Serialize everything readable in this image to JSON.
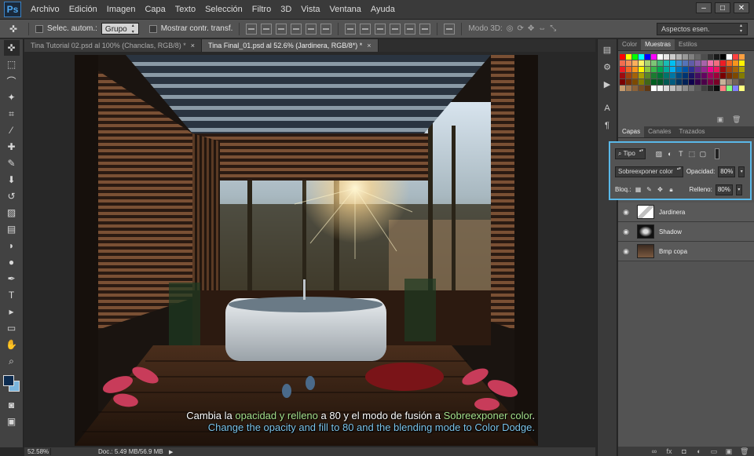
{
  "app": {
    "logo": "Ps"
  },
  "menu": [
    "Archivo",
    "Edición",
    "Imagen",
    "Capa",
    "Texto",
    "Selección",
    "Filtro",
    "3D",
    "Vista",
    "Ventana",
    "Ayuda"
  ],
  "window_controls": {
    "minimize": "–",
    "restore": "□",
    "close": "✕"
  },
  "options_bar": {
    "auto_select_label": "Selec. autom.:",
    "auto_select_target": "Grupo",
    "transform_label": "Mostrar contr. transf.",
    "mode_3d_label": "Modo 3D:",
    "workspace": "Aspectos esen."
  },
  "doc_tabs": [
    {
      "title": "Tina Tutorial 02.psd al 100% (Chanclas, RGB/8) *",
      "close": "×"
    },
    {
      "title": "Tina Final_01.psd al 52.6% (Jardinera, RGB/8*) *",
      "close": "×"
    }
  ],
  "status": {
    "zoom": "52.58%",
    "doc_info": "Doc.: 5.49 MB/56.9 MB",
    "arrow": "▶"
  },
  "caption": {
    "es_parts": [
      "Cambia la ",
      "opacidad y relleno",
      " a 80 y el modo de fusión a ",
      "Sobreexponer color",
      "."
    ],
    "en": "Change the opacity and fill to 80 and the blending mode to Color Dodge."
  },
  "tools": [
    {
      "name": "move-tool-icon",
      "glyph": "✜"
    },
    {
      "name": "marquee-tool-icon",
      "glyph": "⬚"
    },
    {
      "name": "lasso-tool-icon",
      "glyph": "⌒"
    },
    {
      "name": "quick-select-tool-icon",
      "glyph": "✦"
    },
    {
      "name": "crop-tool-icon",
      "glyph": "⌗"
    },
    {
      "name": "eyedropper-tool-icon",
      "glyph": "⁄"
    },
    {
      "name": "healing-brush-tool-icon",
      "glyph": "✚"
    },
    {
      "name": "brush-tool-icon",
      "glyph": "✎"
    },
    {
      "name": "clone-stamp-tool-icon",
      "glyph": "⬇"
    },
    {
      "name": "history-brush-tool-icon",
      "glyph": "↺"
    },
    {
      "name": "eraser-tool-icon",
      "glyph": "▨"
    },
    {
      "name": "gradient-tool-icon",
      "glyph": "▤"
    },
    {
      "name": "blur-tool-icon",
      "glyph": "◗"
    },
    {
      "name": "dodge-tool-icon",
      "glyph": "●"
    },
    {
      "name": "pen-tool-icon",
      "glyph": "✒"
    },
    {
      "name": "type-tool-icon",
      "glyph": "T"
    },
    {
      "name": "path-select-tool-icon",
      "glyph": "▸"
    },
    {
      "name": "shape-tool-icon",
      "glyph": "▭"
    },
    {
      "name": "hand-tool-icon",
      "glyph": "✋"
    },
    {
      "name": "zoom-tool-icon",
      "glyph": "⌕"
    }
  ],
  "colors": {
    "foreground": "#0d2c50",
    "background": "#79b5dd",
    "accent": "#5ab8e8"
  },
  "swatch_panel": {
    "tabs": [
      "Color",
      "Muestras",
      "Estilos"
    ],
    "active": 1
  },
  "layers_panel": {
    "tabs": [
      "Capas",
      "Canales",
      "Trazados"
    ],
    "active": 0,
    "filter_kind": "Tipo",
    "blend_mode": "Sobreexponer color",
    "opacity_label": "Opacidad:",
    "opacity": "80%",
    "lock_label": "Bloq.:",
    "fill_label": "Relleno:",
    "fill": "80%",
    "layers": [
      {
        "name": "Jardinera",
        "visible": "◉"
      },
      {
        "name": "Shadow",
        "visible": "◉"
      },
      {
        "name": "Bmp copa",
        "visible": "◉"
      }
    ]
  }
}
